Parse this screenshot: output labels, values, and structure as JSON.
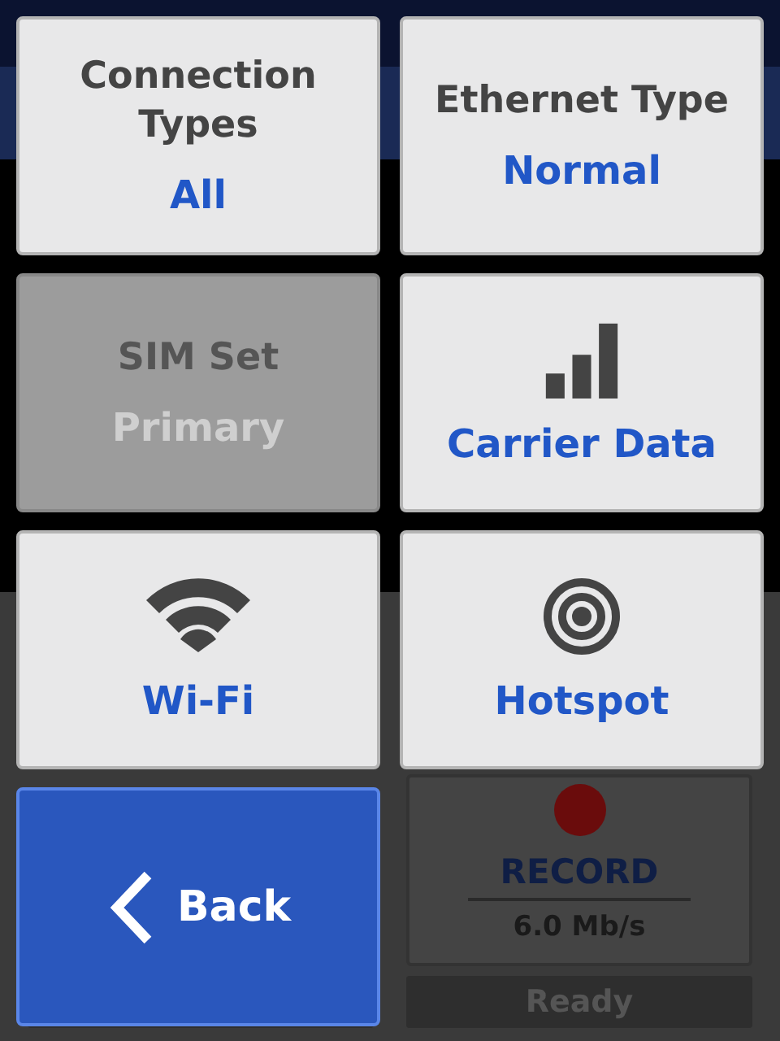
{
  "background": {
    "record_label": "RECORD",
    "bitrate": "6.0 Mb/s",
    "record_status": "Ready"
  },
  "tiles": [
    {
      "kind": "setting",
      "title": "Connection Types",
      "value": "All",
      "disabled": false
    },
    {
      "kind": "setting",
      "title": "Ethernet Type",
      "value": "Normal",
      "disabled": false
    },
    {
      "kind": "setting",
      "title": "SIM Set",
      "value": "Primary",
      "disabled": true
    },
    {
      "kind": "carrier",
      "label": "Carrier Data",
      "disabled": false
    },
    {
      "kind": "wifi",
      "label": "Wi-Fi",
      "disabled": false
    },
    {
      "kind": "hotspot",
      "label": "Hotspot",
      "disabled": false
    },
    {
      "kind": "back",
      "label": "Back",
      "disabled": false
    }
  ]
}
